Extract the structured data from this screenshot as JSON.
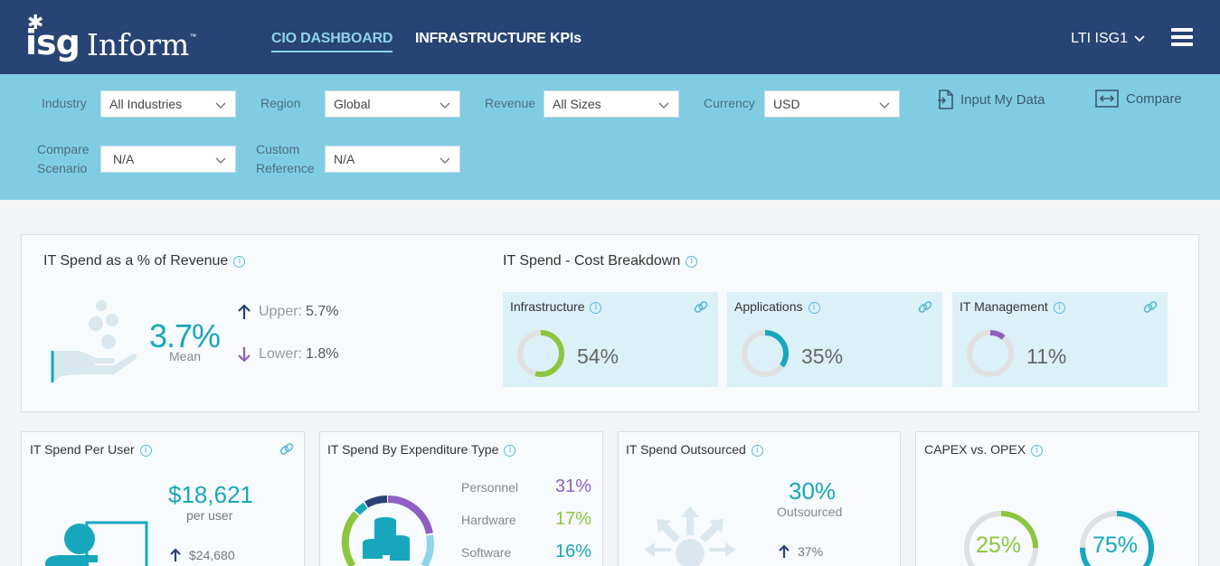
{
  "header": {
    "logo_isg": "isg",
    "logo_inform": "Inform",
    "logo_tm": "™",
    "tabs": [
      {
        "label": "CIO DASHBOARD",
        "active": true
      },
      {
        "label": "INFRASTRUCTURE KPIs",
        "active": false
      }
    ],
    "user": "LTI ISG1"
  },
  "filters": {
    "industry": {
      "label": "Industry",
      "value": "All Industries"
    },
    "region": {
      "label": "Region",
      "value": "Global"
    },
    "revenue": {
      "label": "Revenue",
      "value": "All Sizes"
    },
    "currency": {
      "label": "Currency",
      "value": "USD"
    },
    "compare_scenario": {
      "label_1": "Compare",
      "label_2": "Scenario",
      "value": "N/A"
    },
    "custom_reference": {
      "label_1": "Custom",
      "label_2": "Reference",
      "value": "N/A"
    },
    "input_my_data": "Input My Data",
    "compare": "Compare"
  },
  "it_spend_revenue": {
    "title": "IT Spend as a % of Revenue",
    "mean_value": "3.7%",
    "mean_label": "Mean",
    "upper_label": "Upper:",
    "upper_value": "5.7%",
    "lower_label": "Lower:",
    "lower_value": "1.8%"
  },
  "cost_breakdown": {
    "title": "IT Spend - Cost Breakdown",
    "items": [
      {
        "label": "Infrastructure",
        "value": "54%",
        "fraction": 0.54,
        "color": "#8cc63e"
      },
      {
        "label": "Applications",
        "value": "35%",
        "fraction": 0.35,
        "color": "#17a7bd"
      },
      {
        "label": "IT Management",
        "value": "11%",
        "fraction": 0.11,
        "color": "#8e5fc1"
      }
    ]
  },
  "per_user": {
    "title": "IT Spend Per User",
    "value": "$18,621",
    "label": "per user",
    "upper": "$24,680"
  },
  "expenditure": {
    "title": "IT Spend By Expenditure Type",
    "items": [
      {
        "label": "Personnel",
        "value": "31%",
        "color": "#8e5fc1"
      },
      {
        "label": "Hardware",
        "value": "17%",
        "color": "#8cc63e"
      },
      {
        "label": "Software",
        "value": "16%",
        "color": "#17a7bd"
      }
    ]
  },
  "outsourced": {
    "title": "IT Spend Outsourced",
    "value": "30%",
    "label": "Outsourced",
    "upper": "37%"
  },
  "capex_opex": {
    "title": "CAPEX vs. OPEX",
    "capex": {
      "value": "25%",
      "fraction": 0.25,
      "color": "#8cc63e"
    },
    "opex": {
      "value": "75%",
      "fraction": 0.75,
      "color": "#17a7bd"
    }
  }
}
